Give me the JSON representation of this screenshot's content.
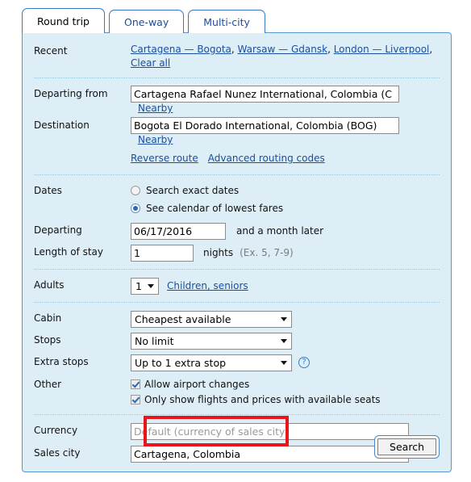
{
  "tabs": [
    {
      "label": "Round trip",
      "active": true
    },
    {
      "label": "One-way",
      "active": false
    },
    {
      "label": "Multi-city",
      "active": false
    }
  ],
  "recent": {
    "label": "Recent",
    "links": [
      "Cartagena — Bogota",
      "Warsaw — Gdansk",
      "London — Liverpool",
      "Clear all"
    ]
  },
  "route": {
    "departing_from_label": "Departing from",
    "departing_from_value": "Cartagena Rafael Nunez International, Colombia (C",
    "destination_label": "Destination",
    "destination_value": "Bogota El Dorado International, Colombia (BOG)",
    "nearby_label": "Nearby",
    "reverse_route_label": "Reverse route",
    "advanced_routing_label": "Advanced routing codes"
  },
  "dates": {
    "label": "Dates",
    "option_exact": "Search exact dates",
    "option_calendar": "See calendar of lowest fares",
    "selected": "calendar",
    "departing_label": "Departing",
    "departing_value": "06/17/2016",
    "departing_suffix": "and a month later",
    "stay_label": "Length of stay",
    "stay_value": "1",
    "stay_unit": "nights",
    "stay_hint": "(Ex. 5, 7-9)"
  },
  "passengers": {
    "adults_label": "Adults",
    "adults_value": "1",
    "children_link": "Children, seniors"
  },
  "options": {
    "cabin_label": "Cabin",
    "cabin_value": "Cheapest available",
    "stops_label": "Stops",
    "stops_value": "No limit",
    "extra_stops_label": "Extra stops",
    "extra_stops_value": "Up to 1 extra stop",
    "help_glyph": "?",
    "other_label": "Other",
    "check_airport_changes": "Allow airport changes",
    "check_available_seats": "Only show flights and prices with available seats",
    "currency_label": "Currency",
    "currency_placeholder": "Default (currency of sales city)",
    "currency_value": "",
    "sales_city_label": "Sales city",
    "sales_city_value": "Cartagena, Colombia"
  },
  "actions": {
    "search_label": "Search"
  },
  "colors": {
    "panel_bg": "#deeef7",
    "panel_border": "#5b95cd",
    "link": "#1a4fa0",
    "accent": "#3b78c3",
    "highlight": "#e8161a"
  }
}
